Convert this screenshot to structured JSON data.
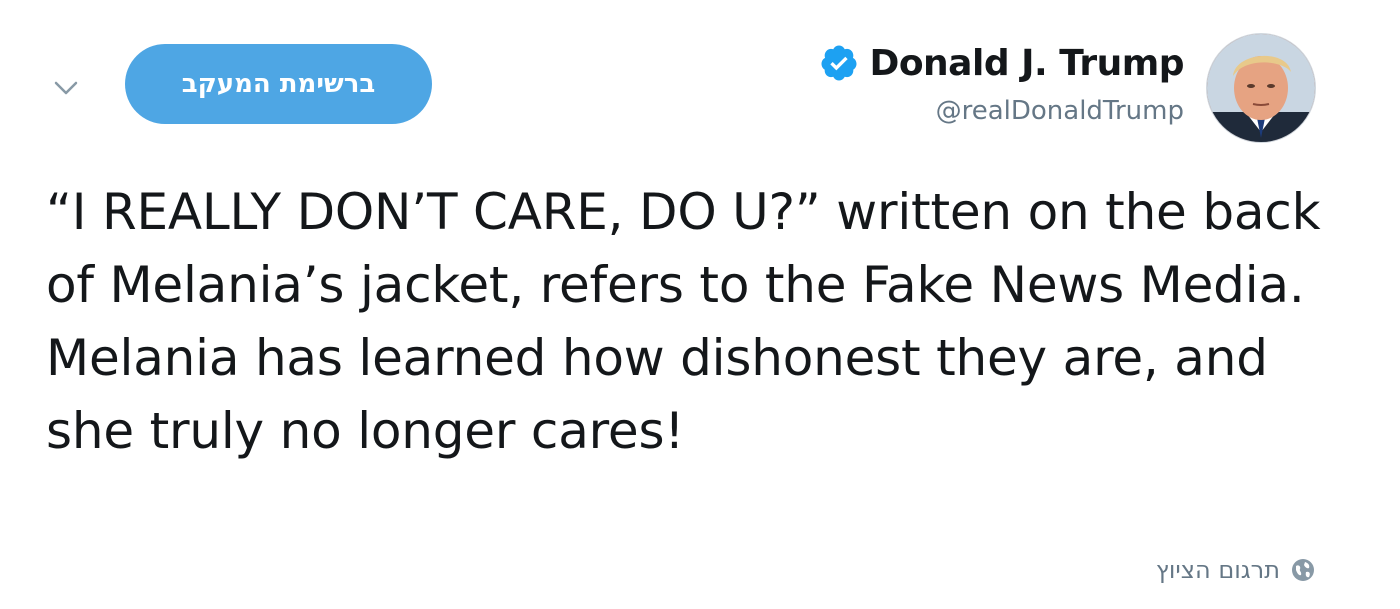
{
  "author": {
    "display_name": "Donald J. Trump",
    "handle": "@realDonaldTrump",
    "verified": true,
    "avatar_icon": "profile-photo"
  },
  "follow_button": {
    "label": "ברשימת המעקב",
    "color": "#4ea6e4"
  },
  "tweet": {
    "text": "“I REALLY DON’T CARE, DO U?” written on the back of Melania’s jacket, refers to the Fake News Media. Melania has learned how dishonest they are, and she truly no longer cares!"
  },
  "translate": {
    "label": "תרגום הציוץ",
    "icon": "globe-icon"
  },
  "colors": {
    "verified_blue": "#1da1f2",
    "secondary_text": "#657786",
    "primary_text": "#14171a"
  }
}
